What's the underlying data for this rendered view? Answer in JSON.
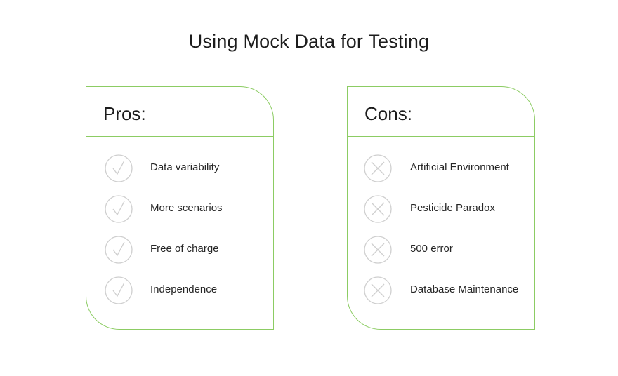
{
  "title": "Using Mock Data for Testing",
  "colors": {
    "accent_green": "#8ccc63",
    "icon_gray": "#cfcfcf"
  },
  "pros": {
    "title": "Pros:",
    "icon": "check-icon",
    "items": [
      {
        "label": "Data variability"
      },
      {
        "label": "More scenarios"
      },
      {
        "label": "Free of charge"
      },
      {
        "label": "Independence"
      }
    ]
  },
  "cons": {
    "title": "Cons:",
    "icon": "cross-icon",
    "items": [
      {
        "label": "Artificial Environment"
      },
      {
        "label": "Pesticide Paradox"
      },
      {
        "label": "500 error"
      },
      {
        "label": "Database Maintenance"
      }
    ]
  }
}
